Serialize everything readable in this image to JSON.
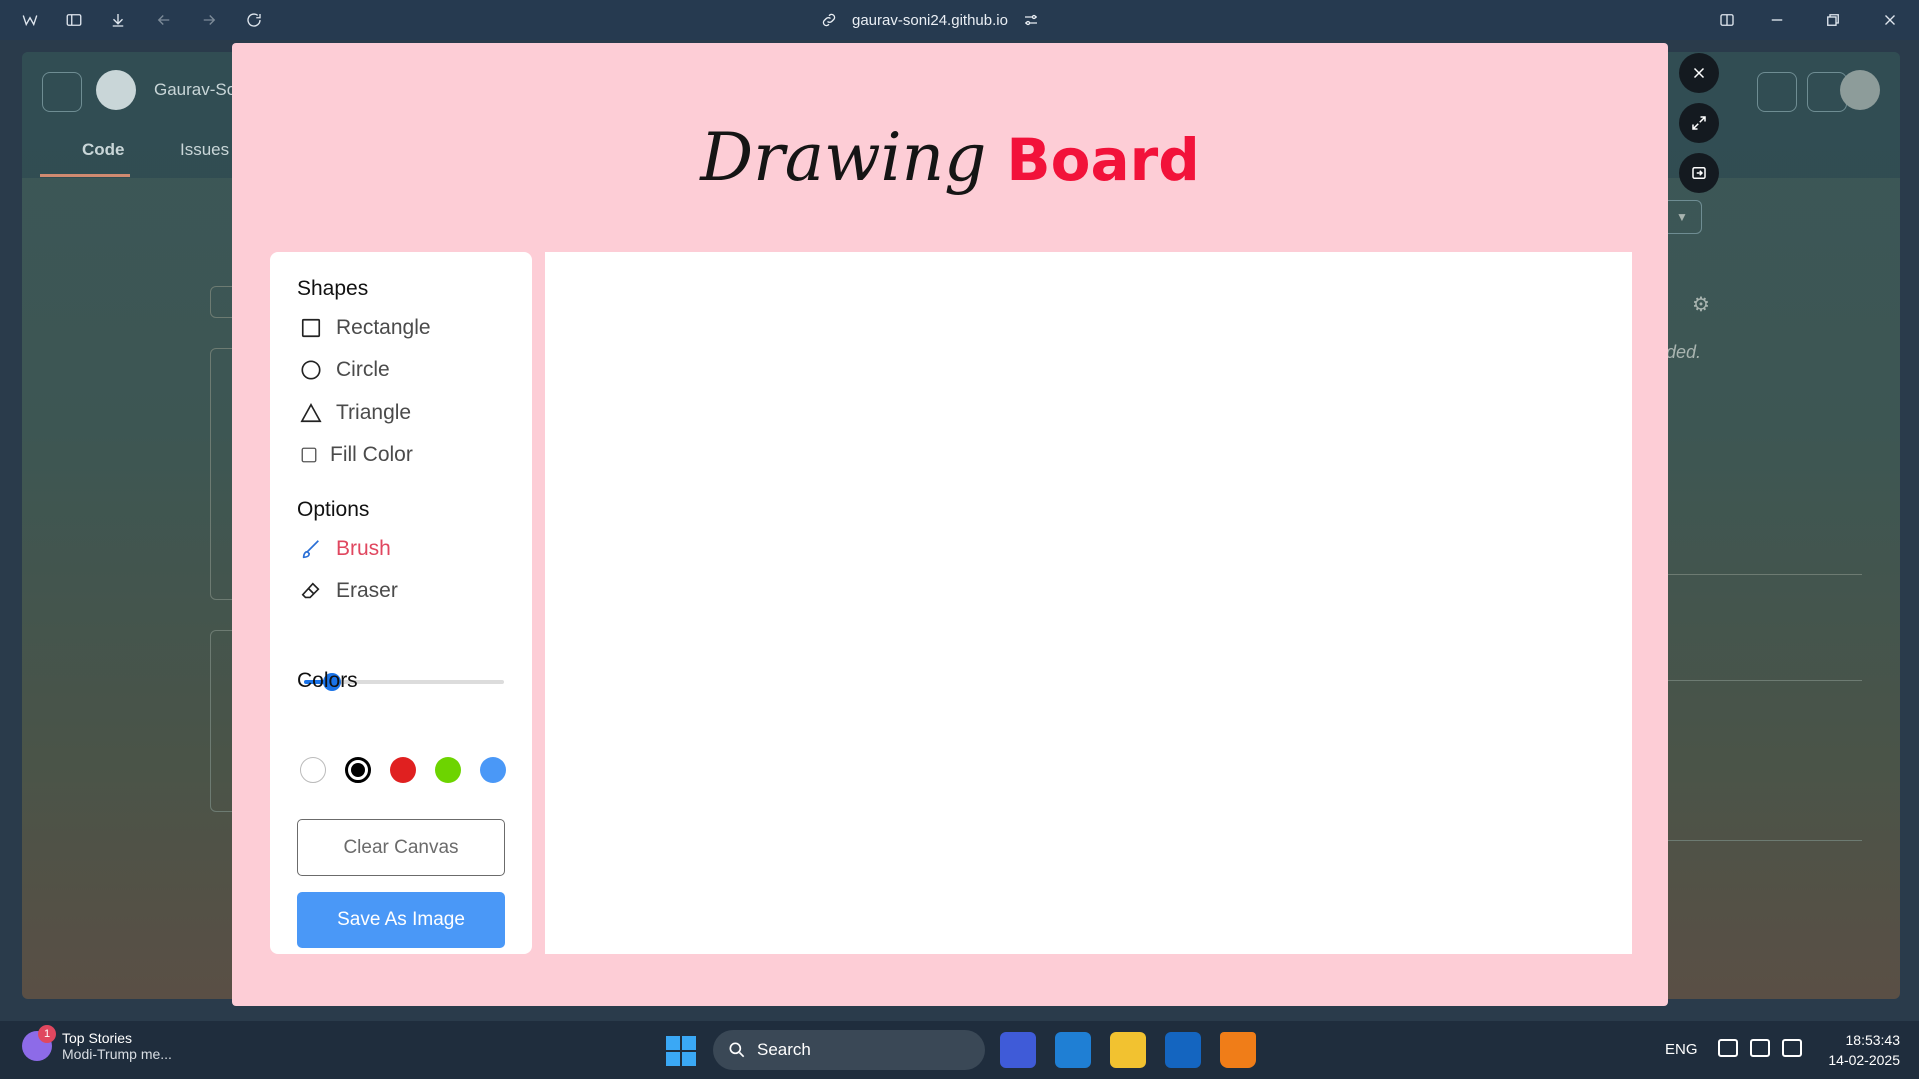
{
  "browser": {
    "url": "gaurav-soni24.github.io"
  },
  "background_page": {
    "owner": "Gaurav-So",
    "tabs": [
      "Code",
      "Issues"
    ],
    "fragment_text": "ided."
  },
  "app": {
    "title_part1": "Drawing",
    "title_part2": "Board",
    "title_part2_color": "#f2123a",
    "background_color": "#fdcdd6",
    "sections": {
      "shapes": "Shapes",
      "options": "Options",
      "colors": "Colors"
    },
    "shapes": [
      {
        "label": "Rectangle",
        "icon": "square-outline-icon"
      },
      {
        "label": "Circle",
        "icon": "circle-outline-icon"
      },
      {
        "label": "Triangle",
        "icon": "triangle-outline-icon"
      }
    ],
    "fill_color": {
      "label": "Fill Color",
      "checked": false
    },
    "options": [
      {
        "label": "Brush",
        "icon": "brush-icon",
        "active": true
      },
      {
        "label": "Eraser",
        "icon": "eraser-icon",
        "active": false
      }
    ],
    "brush_size": {
      "min": 1,
      "max": 30,
      "value": 5
    },
    "colors": [
      {
        "hex": "#ffffff",
        "selected": false
      },
      {
        "hex": "#000000",
        "selected": true
      },
      {
        "hex": "#e02020",
        "selected": false
      },
      {
        "hex": "#6dd400",
        "selected": false
      },
      {
        "hex": "#4a98f7",
        "selected": false
      }
    ],
    "buttons": {
      "clear": "Clear Canvas",
      "save": "Save As Image"
    }
  },
  "taskbar": {
    "news_title": "Top Stories",
    "news_sub": "Modi-Trump me...",
    "news_badge": "1",
    "search_label": "Search",
    "language": "ENG",
    "time": "18:53:43",
    "date": "14-02-2025"
  }
}
